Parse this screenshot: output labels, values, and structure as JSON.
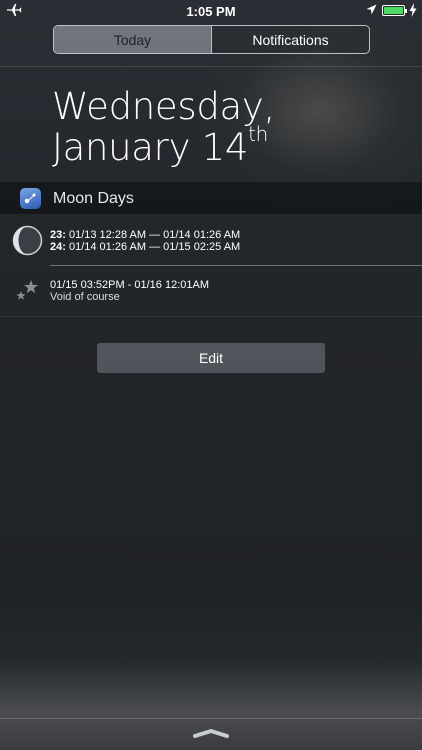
{
  "status_bar": {
    "time": "1:05 PM",
    "icons": [
      "airplane-icon",
      "location-arrow-icon",
      "battery-icon",
      "charging-icon"
    ],
    "battery_color": "#4cd964"
  },
  "tabs": [
    {
      "label": "Today",
      "active": true
    },
    {
      "label": "Notifications",
      "active": false
    }
  ],
  "date": {
    "line1": "Wednesday,",
    "line2": "January 14",
    "suffix": "th"
  },
  "widget": {
    "title": "Moon Days",
    "icon": "moon-days-app-icon",
    "moon_days": [
      {
        "day": "23:",
        "range": "01/13 12:28 AM — 01/14 01:26 AM"
      },
      {
        "day": "24:",
        "range": "01/14 01:26 AM — 01/15 02:25 AM"
      }
    ],
    "void": {
      "range": "01/15 03:52PM - 01/16 12:01AM",
      "label": "Void of course"
    }
  },
  "edit_button": {
    "label": "Edit"
  }
}
